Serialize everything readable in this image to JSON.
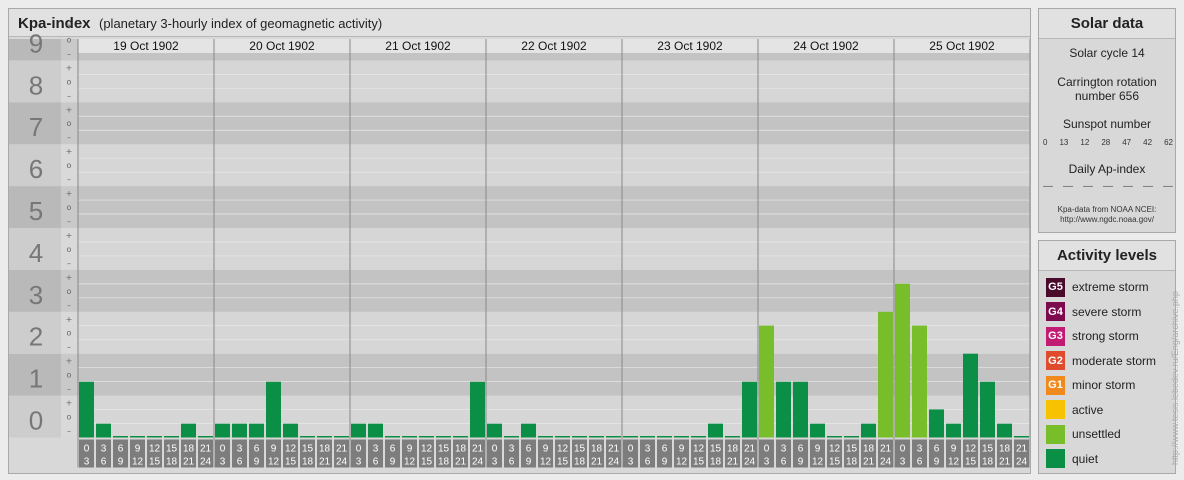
{
  "header": {
    "title": "Kpa-index",
    "subtitle": "(planetary 3-hourly index of geomagnetic activity)"
  },
  "chart_data": {
    "type": "bar",
    "days": [
      "19 Oct 1902",
      "20 Oct 1902",
      "21 Oct 1902",
      "22 Oct 1902",
      "23 Oct 1902",
      "24 Oct 1902",
      "25 Oct 1902"
    ],
    "interval_start_labels": [
      "0",
      "3",
      "6",
      "9",
      "12",
      "15",
      "18",
      "21"
    ],
    "interval_end_labels": [
      "3",
      "6",
      "9",
      "12",
      "15",
      "18",
      "21",
      "24"
    ],
    "y_tick_labels": [
      "0",
      "1",
      "2",
      "3",
      "4",
      "5",
      "6",
      "7",
      "8",
      "9"
    ],
    "thirds_labels": [
      "+",
      "o",
      "–"
    ],
    "ylim": [
      0,
      9.33
    ],
    "kp_values": [
      1.33,
      0.33,
      0,
      0,
      0,
      0,
      0.33,
      0,
      0.33,
      0.33,
      0.33,
      1.33,
      0.33,
      0,
      0,
      0,
      0.33,
      0.33,
      0,
      0,
      0,
      0,
      0,
      1.33,
      0.33,
      0,
      0.33,
      0,
      0,
      0,
      0,
      0,
      0,
      0,
      0,
      0,
      0,
      0.33,
      0,
      1.33,
      2.67,
      1.33,
      1.33,
      0.33,
      0,
      0,
      0.33,
      3,
      3.67,
      2.67,
      0.67,
      0.33,
      2,
      1.33,
      0.33,
      0
    ],
    "last_value": 0.33,
    "colors": {
      "quiet": "#0b8e45",
      "unsettled": "#78bd2a",
      "active": "#f7c300"
    }
  },
  "solar": {
    "title": "Solar data",
    "cycle": "Solar cycle 14",
    "rotation_line1": "Carrington rotation",
    "rotation_line2": "number 656",
    "sunspot_title": "Sunspot number",
    "sunspot_values": [
      "0",
      "13",
      "12",
      "28",
      "47",
      "42",
      "62"
    ],
    "ap_title": "Daily Ap-index",
    "ap_values": [
      "—",
      "—",
      "—",
      "—",
      "—",
      "—",
      "—"
    ],
    "source_line1": "Kpa-data from NOAA NCEI:",
    "source_line2": "http://www.ngdc.noaa.gov/"
  },
  "legend": {
    "title": "Activity levels",
    "items": [
      {
        "badge": "G5",
        "label": "extreme storm",
        "color": "#4a0a2a"
      },
      {
        "badge": "G4",
        "label": "severe storm",
        "color": "#7d0a4e"
      },
      {
        "badge": "G3",
        "label": "strong storm",
        "color": "#c21b74"
      },
      {
        "badge": "G2",
        "label": "moderate storm",
        "color": "#e04b2d"
      },
      {
        "badge": "G1",
        "label": "minor storm",
        "color": "#f08a1c"
      },
      {
        "badge": "",
        "label": "active",
        "color": "#f7c300"
      },
      {
        "badge": "",
        "label": "unsettled",
        "color": "#78bd2a"
      },
      {
        "badge": "",
        "label": "quiet",
        "color": "#0b8e45"
      }
    ]
  },
  "watermark": "http://www.tesis.lebedev.ru/Eng/archive.php"
}
